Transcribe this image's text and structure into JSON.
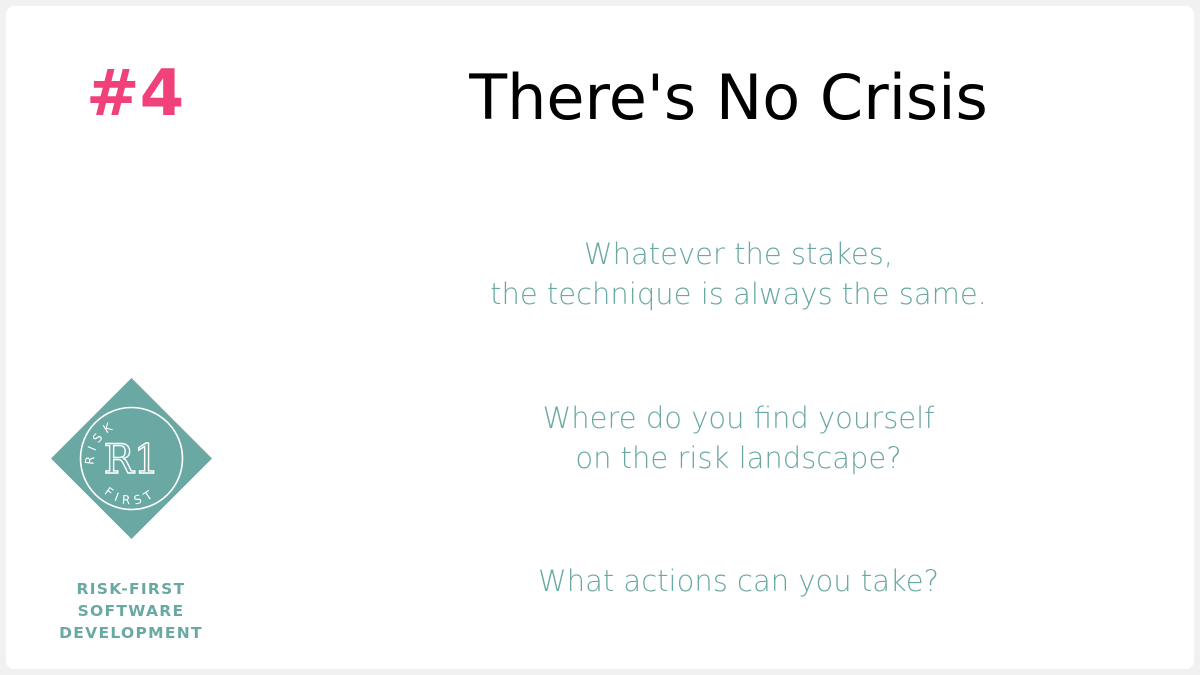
{
  "slide": {
    "number": "#4",
    "title": "There's No Crisis",
    "paragraphs": [
      {
        "lines": [
          "Whatever the stakes,",
          "the technique is always the same."
        ]
      },
      {
        "lines": [
          "Where do you find yourself",
          "on the risk landscape?"
        ]
      },
      {
        "lines": [
          "What actions can you take?"
        ]
      }
    ]
  },
  "brand": {
    "logo": {
      "icon": "risk-first-logo-icon",
      "letters": "R1",
      "top_text": "RISK",
      "bottom_text": "FIRST"
    },
    "lines": [
      "RISK-FIRST",
      "SOFTWARE",
      "DEVELOPMENT"
    ]
  },
  "colors": {
    "accent": "#f0417a",
    "brand": "#6aa8a3",
    "title": "#000000",
    "background": "#ffffff"
  }
}
